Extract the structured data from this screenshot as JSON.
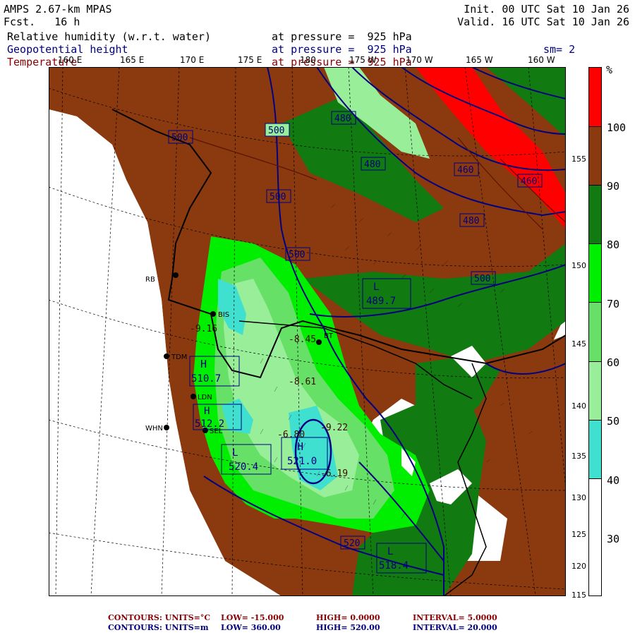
{
  "header": {
    "model": "AMPS 2.67-km MPAS",
    "fcst": "Fcst.   16 h",
    "init": "Init. 00 UTC Sat 10 Jan 26",
    "valid": "Valid. 16 UTC Sat 10 Jan 26",
    "fields": [
      {
        "name": "Relative humidity (w.r.t. water)",
        "level": "at pressure =  925 hPa",
        "color": "#000000"
      },
      {
        "name": "Geopotential height",
        "level": "at pressure =  925 hPa",
        "color": "#000080"
      },
      {
        "name": "Temperature",
        "level": "at pressure =  925 hPa",
        "color": "#8b0000"
      }
    ],
    "smoothing": "sm= 2"
  },
  "longitudes": [
    "160 E",
    "165 E",
    "170 E",
    "175 E",
    "180",
    "175 W",
    "170 W",
    "165 W",
    "160 W"
  ],
  "latitudes": [
    "155",
    "150",
    "145",
    "140",
    "135",
    "130",
    "125",
    "120",
    "115"
  ],
  "colorbar": {
    "unit": "%",
    "levels": [
      "100",
      "90",
      "80",
      "70",
      "60",
      "50",
      "40",
      "30"
    ],
    "colors": [
      "#ff0000",
      "#8b3a0f",
      "#117a11",
      "#00ee00",
      "#66e066",
      "#99ee99",
      "#40e0d0",
      "#ffffff"
    ]
  },
  "stations": [
    {
      "name": "BIS"
    },
    {
      "name": "TDM"
    },
    {
      "name": "LDN"
    },
    {
      "name": "WHN"
    },
    {
      "name": "SEL"
    },
    {
      "name": "BT"
    },
    {
      "name": "RB"
    }
  ],
  "height_labels": [
    "500",
    "500",
    "500",
    "500",
    "480",
    "480",
    "460",
    "460",
    "480",
    "500",
    "520"
  ],
  "temp_labels": [
    "-8.61",
    "-9.22",
    "-8.45",
    "-6.80",
    "-6.19",
    "-9.16"
  ],
  "highs": [
    {
      "label": "H",
      "value": "521.0"
    },
    {
      "label": "H",
      "value": "510.7"
    },
    {
      "label": "H",
      "value": "512.2"
    },
    {
      "label": "L",
      "value": "489.7"
    },
    {
      "label": "L",
      "value": "518.4"
    },
    {
      "label": "L",
      "value": "520.4"
    }
  ],
  "footer": {
    "line1": {
      "label": "CONTOURS:  UNITS=°C",
      "low": "LOW=  -15.000",
      "high": "HIGH=  0.0000",
      "interval": "INTERVAL=   5.0000",
      "color": "#8b0000"
    },
    "line2": {
      "label": "CONTOURS:  UNITS=m",
      "low": "LOW=  360.00",
      "high": "HIGH=  520.00",
      "interval": "INTERVAL=   20.000",
      "color": "#000080"
    }
  }
}
